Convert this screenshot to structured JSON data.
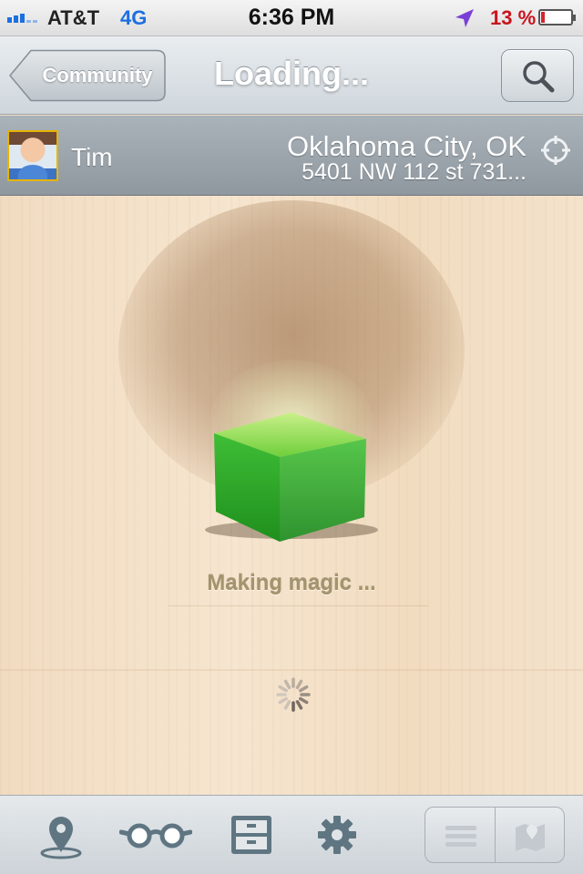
{
  "status_bar": {
    "carrier": "AT&T",
    "network": "4G",
    "time": "6:36 PM",
    "battery_text": "13 %",
    "battery_level": 0.13,
    "icons": [
      "signal-bars-icon",
      "location-arrow-icon",
      "battery-icon"
    ]
  },
  "nav": {
    "back_label": "Community",
    "title": "Loading...",
    "search_icon": "search-icon"
  },
  "user": {
    "name": "Tim",
    "city": "Oklahoma City, OK",
    "address": "5401 NW 112 st 731...",
    "target_icon": "crosshair-icon"
  },
  "main": {
    "status_text": "Making magic ...",
    "loading_icon": "spinner-icon",
    "illustration": "green-cube-icon"
  },
  "tab_bar": {
    "items": [
      "map-pin-icon",
      "glasses-icon",
      "file-cabinet-icon",
      "gear-icon"
    ],
    "view_toggle": [
      "list-icon",
      "map-icon"
    ]
  },
  "colors": {
    "accent_blue": "#1c6fe0",
    "battery_red": "#c8141e",
    "cube_green": "#2fa92a",
    "tab_icon": "#5f7682"
  }
}
